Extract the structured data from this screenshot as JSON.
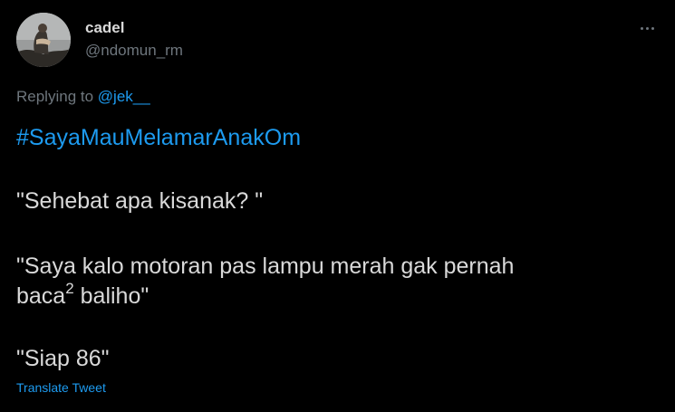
{
  "author": {
    "display_name": "cadel",
    "handle": "@ndomun_rm"
  },
  "reply": {
    "prefix": "Replying to",
    "mention": "@jek__"
  },
  "tweet": {
    "hashtag": "#SayaMauMelamarAnakOm",
    "line1": "\"Sehebat apa kisanak? \"",
    "line2": "\"Saya kalo motoran pas lampu merah gak pernah",
    "line3_a": "baca",
    "line3_sup": "2",
    "line3_b": " baliho\"",
    "line4": "\"Siap 86\""
  },
  "translate_label": "Translate Tweet",
  "icons": {
    "more": "more-horizontal-icon"
  },
  "colors": {
    "background": "#000000",
    "text": "#d9d9d9",
    "secondary": "#6e767d",
    "link": "#1d9bf0"
  }
}
